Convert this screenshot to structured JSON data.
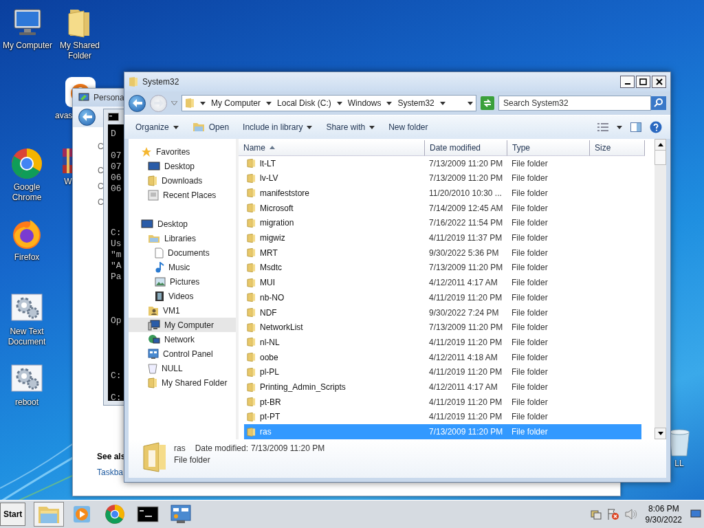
{
  "desktop_icons": [
    {
      "label": "My Computer",
      "kind": "computer"
    },
    {
      "label": "My Shared Folder",
      "kind": "folder"
    },
    {
      "label": "avas",
      "kind": "avast"
    },
    {
      "label": "Google Chrome",
      "kind": "chrome"
    },
    {
      "label": "W",
      "kind": "archive"
    },
    {
      "label": "Firefox",
      "kind": "firefox"
    },
    {
      "label": "New Text Document",
      "kind": "script"
    },
    {
      "label": "reboot",
      "kind": "script"
    },
    {
      "label": "LL",
      "kind": "bin"
    }
  ],
  "background_window": {
    "title": "Persona",
    "links": [
      "C",
      "C",
      "C",
      "C"
    ],
    "see_also": "See als",
    "link": "Taskba"
  },
  "console": {
    "lines": [
      "D",
      "07",
      "07",
      "06",
      "06",
      "C:",
      "Us",
      "\"m",
      "\"A",
      "Pa",
      "Op",
      "C:",
      "C:"
    ]
  },
  "explorer": {
    "title": "System32",
    "breadcrumb": [
      "My Computer",
      "Local Disk (C:)",
      "Windows",
      "System32"
    ],
    "search": {
      "placeholder": "Search System32"
    },
    "toolbar": [
      {
        "label": "Organize",
        "kind": "menu"
      },
      {
        "label": "Open",
        "kind": "open"
      },
      {
        "label": "Include in library",
        "kind": "menu"
      },
      {
        "label": "Share with",
        "kind": "menu"
      },
      {
        "label": "New folder",
        "kind": "plain"
      }
    ],
    "nav": [
      {
        "label": "Favorites",
        "kind": "star",
        "selected": false,
        "children": [
          {
            "label": "Desktop",
            "kind": "monitor",
            "selected": false
          },
          {
            "label": "Downloads",
            "kind": "folder",
            "selected": false
          },
          {
            "label": "Recent Places",
            "kind": "recent",
            "selected": false
          }
        ]
      },
      {
        "label": "Desktop",
        "kind": "monitor",
        "selected": false,
        "children": [
          {
            "label": "Libraries",
            "kind": "library",
            "selected": false,
            "children": [
              {
                "label": "Documents",
                "kind": "document",
                "selected": false
              },
              {
                "label": "Music",
                "kind": "music",
                "selected": false
              },
              {
                "label": "Pictures",
                "kind": "pictures",
                "selected": false
              },
              {
                "label": "Videos",
                "kind": "video",
                "selected": false
              }
            ]
          },
          {
            "label": "VM1",
            "kind": "user",
            "selected": false
          },
          {
            "label": "My Computer",
            "kind": "computer",
            "selected": true
          },
          {
            "label": "Network",
            "kind": "network",
            "selected": false
          },
          {
            "label": "Control Panel",
            "kind": "control",
            "selected": false
          },
          {
            "label": "NULL",
            "kind": "bin",
            "selected": false
          },
          {
            "label": "My Shared Folder",
            "kind": "folder",
            "selected": false
          }
        ]
      }
    ],
    "columns": [
      {
        "label": "Name",
        "sorted": true
      },
      {
        "label": "Date modified",
        "sorted": false
      },
      {
        "label": "Type",
        "sorted": false
      },
      {
        "label": "Size",
        "sorted": false
      }
    ],
    "rows": [
      {
        "name": "lt-LT",
        "date": "7/13/2009 11:20 PM",
        "type": "File folder",
        "selected": false
      },
      {
        "name": "lv-LV",
        "date": "7/13/2009 11:20 PM",
        "type": "File folder",
        "selected": false
      },
      {
        "name": "manifeststore",
        "date": "11/20/2010 10:30 ...",
        "type": "File folder",
        "selected": false
      },
      {
        "name": "Microsoft",
        "date": "7/14/2009 12:45 AM",
        "type": "File folder",
        "selected": false
      },
      {
        "name": "migration",
        "date": "7/16/2022 11:54 PM",
        "type": "File folder",
        "selected": false
      },
      {
        "name": "migwiz",
        "date": "4/11/2019 11:37 PM",
        "type": "File folder",
        "selected": false
      },
      {
        "name": "MRT",
        "date": "9/30/2022 5:36 PM",
        "type": "File folder",
        "selected": false
      },
      {
        "name": "Msdtc",
        "date": "7/13/2009 11:20 PM",
        "type": "File folder",
        "selected": false
      },
      {
        "name": "MUI",
        "date": "4/12/2011 4:17 AM",
        "type": "File folder",
        "selected": false
      },
      {
        "name": "nb-NO",
        "date": "4/11/2019 11:20 PM",
        "type": "File folder",
        "selected": false
      },
      {
        "name": "NDF",
        "date": "9/30/2022 7:24 PM",
        "type": "File folder",
        "selected": false
      },
      {
        "name": "NetworkList",
        "date": "7/13/2009 11:20 PM",
        "type": "File folder",
        "selected": false
      },
      {
        "name": "nl-NL",
        "date": "4/11/2019 11:20 PM",
        "type": "File folder",
        "selected": false
      },
      {
        "name": "oobe",
        "date": "4/12/2011 4:18 AM",
        "type": "File folder",
        "selected": false
      },
      {
        "name": "pl-PL",
        "date": "4/11/2019 11:20 PM",
        "type": "File folder",
        "selected": false
      },
      {
        "name": "Printing_Admin_Scripts",
        "date": "4/12/2011 4:17 AM",
        "type": "File folder",
        "selected": false
      },
      {
        "name": "pt-BR",
        "date": "4/11/2019 11:20 PM",
        "type": "File folder",
        "selected": false
      },
      {
        "name": "pt-PT",
        "date": "4/11/2019 11:20 PM",
        "type": "File folder",
        "selected": false
      },
      {
        "name": "ras",
        "date": "7/13/2009 11:20 PM",
        "type": "File folder",
        "selected": true
      }
    ],
    "details": {
      "name": "ras",
      "date_label": "Date modified:",
      "date": "7/13/2009 11:20 PM",
      "type": "File folder"
    }
  },
  "taskbar": {
    "start": "Start",
    "apps": [
      {
        "kind": "explorer",
        "active": true
      },
      {
        "kind": "media",
        "active": false
      },
      {
        "kind": "chrome",
        "active": false
      },
      {
        "kind": "console",
        "active": false
      },
      {
        "kind": "control",
        "active": false
      }
    ],
    "time": "8:06 PM",
    "date": "9/30/2022"
  }
}
